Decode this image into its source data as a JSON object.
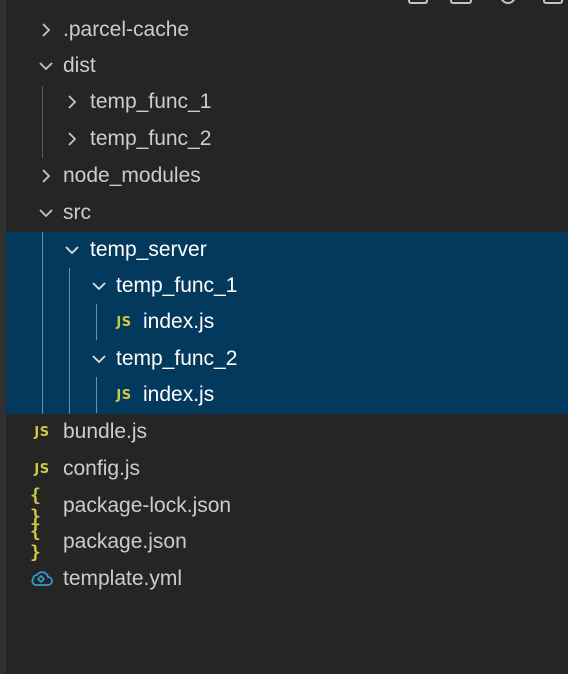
{
  "toolbar": {
    "icons": [
      "new-file-icon",
      "new-folder-icon",
      "refresh-icon",
      "collapse-all-icon"
    ]
  },
  "tree": {
    "parcel_cache": {
      "label": ".parcel-cache",
      "state": "collapsed"
    },
    "dist": {
      "label": "dist",
      "state": "expanded",
      "children": {
        "temp_func_1": {
          "label": "temp_func_1",
          "state": "collapsed"
        },
        "temp_func_2": {
          "label": "temp_func_2",
          "state": "collapsed"
        }
      }
    },
    "node_modules": {
      "label": "node_modules",
      "state": "collapsed"
    },
    "src": {
      "label": "src",
      "state": "expanded",
      "children": {
        "temp_server": {
          "label": "temp_server",
          "state": "expanded",
          "selected": true,
          "children": {
            "temp_func_1": {
              "label": "temp_func_1",
              "state": "expanded",
              "children": {
                "index": {
                  "label": "index.js",
                  "badge": "JS"
                }
              }
            },
            "temp_func_2": {
              "label": "temp_func_2",
              "state": "expanded",
              "children": {
                "index": {
                  "label": "index.js",
                  "badge": "JS"
                }
              }
            }
          }
        }
      }
    },
    "bundle": {
      "label": "bundle.js",
      "badge": "JS"
    },
    "config": {
      "label": "config.js",
      "badge": "JS"
    },
    "package_lock": {
      "label": "package-lock.json",
      "badge": "{ }"
    },
    "package": {
      "label": "package.json",
      "badge": "{ }"
    },
    "template": {
      "label": "template.yml",
      "icon": "cloud-formation-icon"
    }
  },
  "colors": {
    "background": "#252526",
    "selection": "#04395e",
    "text": "#cccccc",
    "selected_text": "#ffffff",
    "js_badge": "#cbcb41",
    "json_badge": "#cbcb41",
    "yml_icon": "#2f9ecf"
  }
}
